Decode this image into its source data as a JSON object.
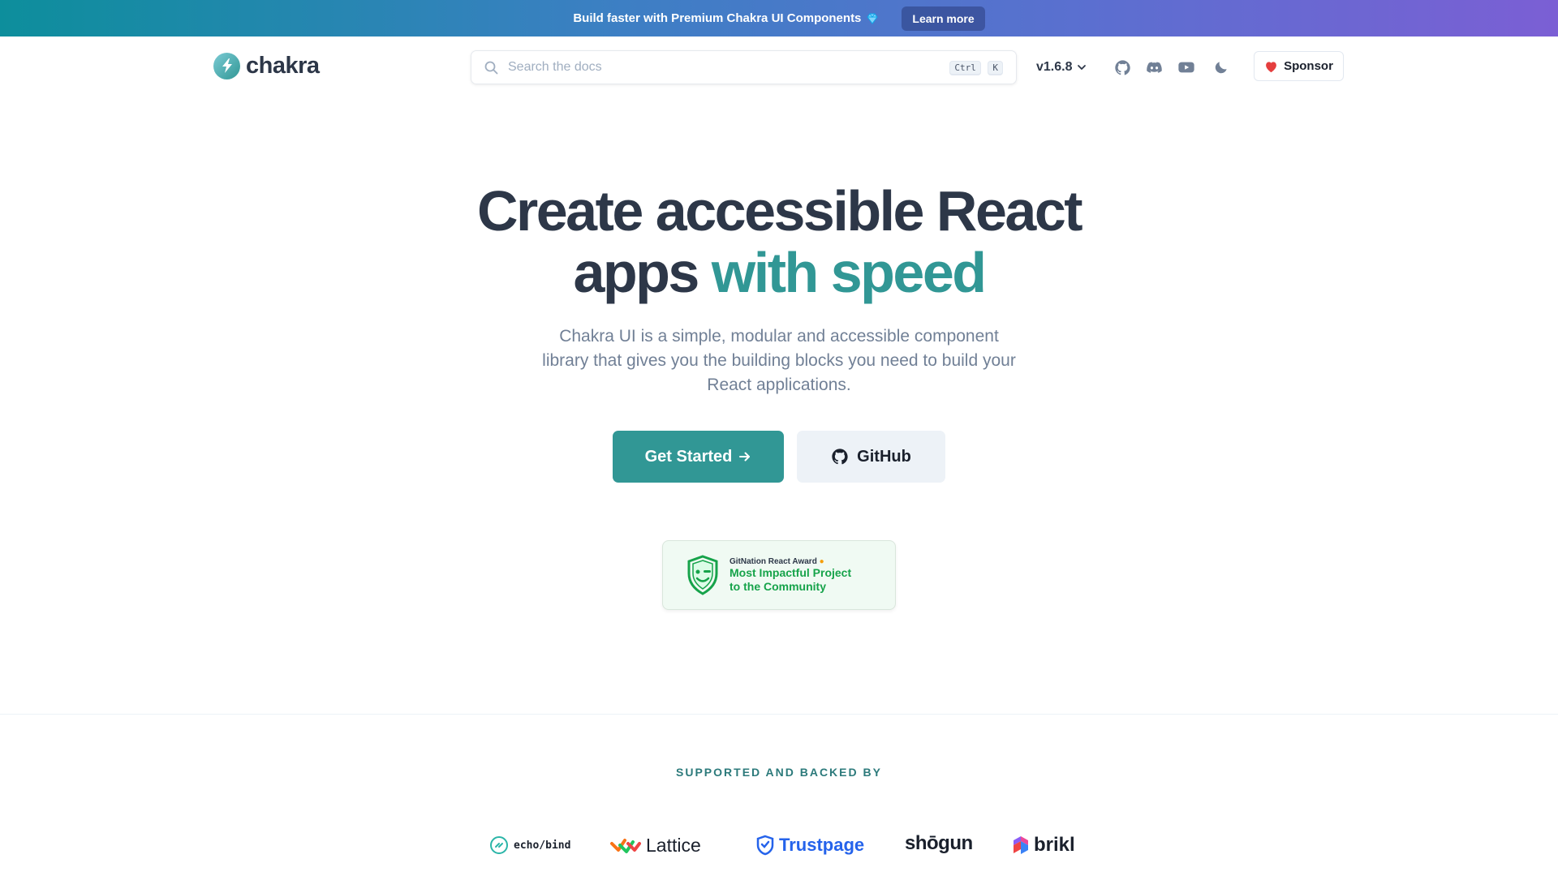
{
  "banner": {
    "text": "Build faster with Premium Chakra UI Components",
    "icon": "gem-icon",
    "button_label": "Learn more"
  },
  "header": {
    "logo_text": "chakra",
    "search_placeholder": "Search the docs",
    "shortcut_keys": [
      "Ctrl",
      "K"
    ],
    "version": "v1.6.8",
    "icons": [
      "github-icon",
      "discord-icon",
      "youtube-icon",
      "moon-icon"
    ],
    "sponsor_label": "Sponsor"
  },
  "hero": {
    "title_line1": "Create accessible React",
    "title_line2_plain": "apps",
    "title_line2_accent": "with speed",
    "subtitle": "Chakra UI is a simple, modular and accessible component library that gives you the building blocks you need to build your React applications.",
    "primary_cta": "Get Started",
    "secondary_cta": "GitHub"
  },
  "award": {
    "eyebrow": "GitNation React Award",
    "title_line1": "Most Impactful Project",
    "title_line2": "to the Community"
  },
  "backers": {
    "label": "SUPPORTED AND BACKED BY",
    "items": [
      {
        "name": "echo/bind"
      },
      {
        "name": "Lattice"
      },
      {
        "name": "Trustpage"
      },
      {
        "name": "shōgun"
      },
      {
        "name": "brikl"
      }
    ]
  },
  "colors": {
    "accent": "#319795",
    "heading": "#2d3748",
    "award_green": "#16a34a"
  }
}
